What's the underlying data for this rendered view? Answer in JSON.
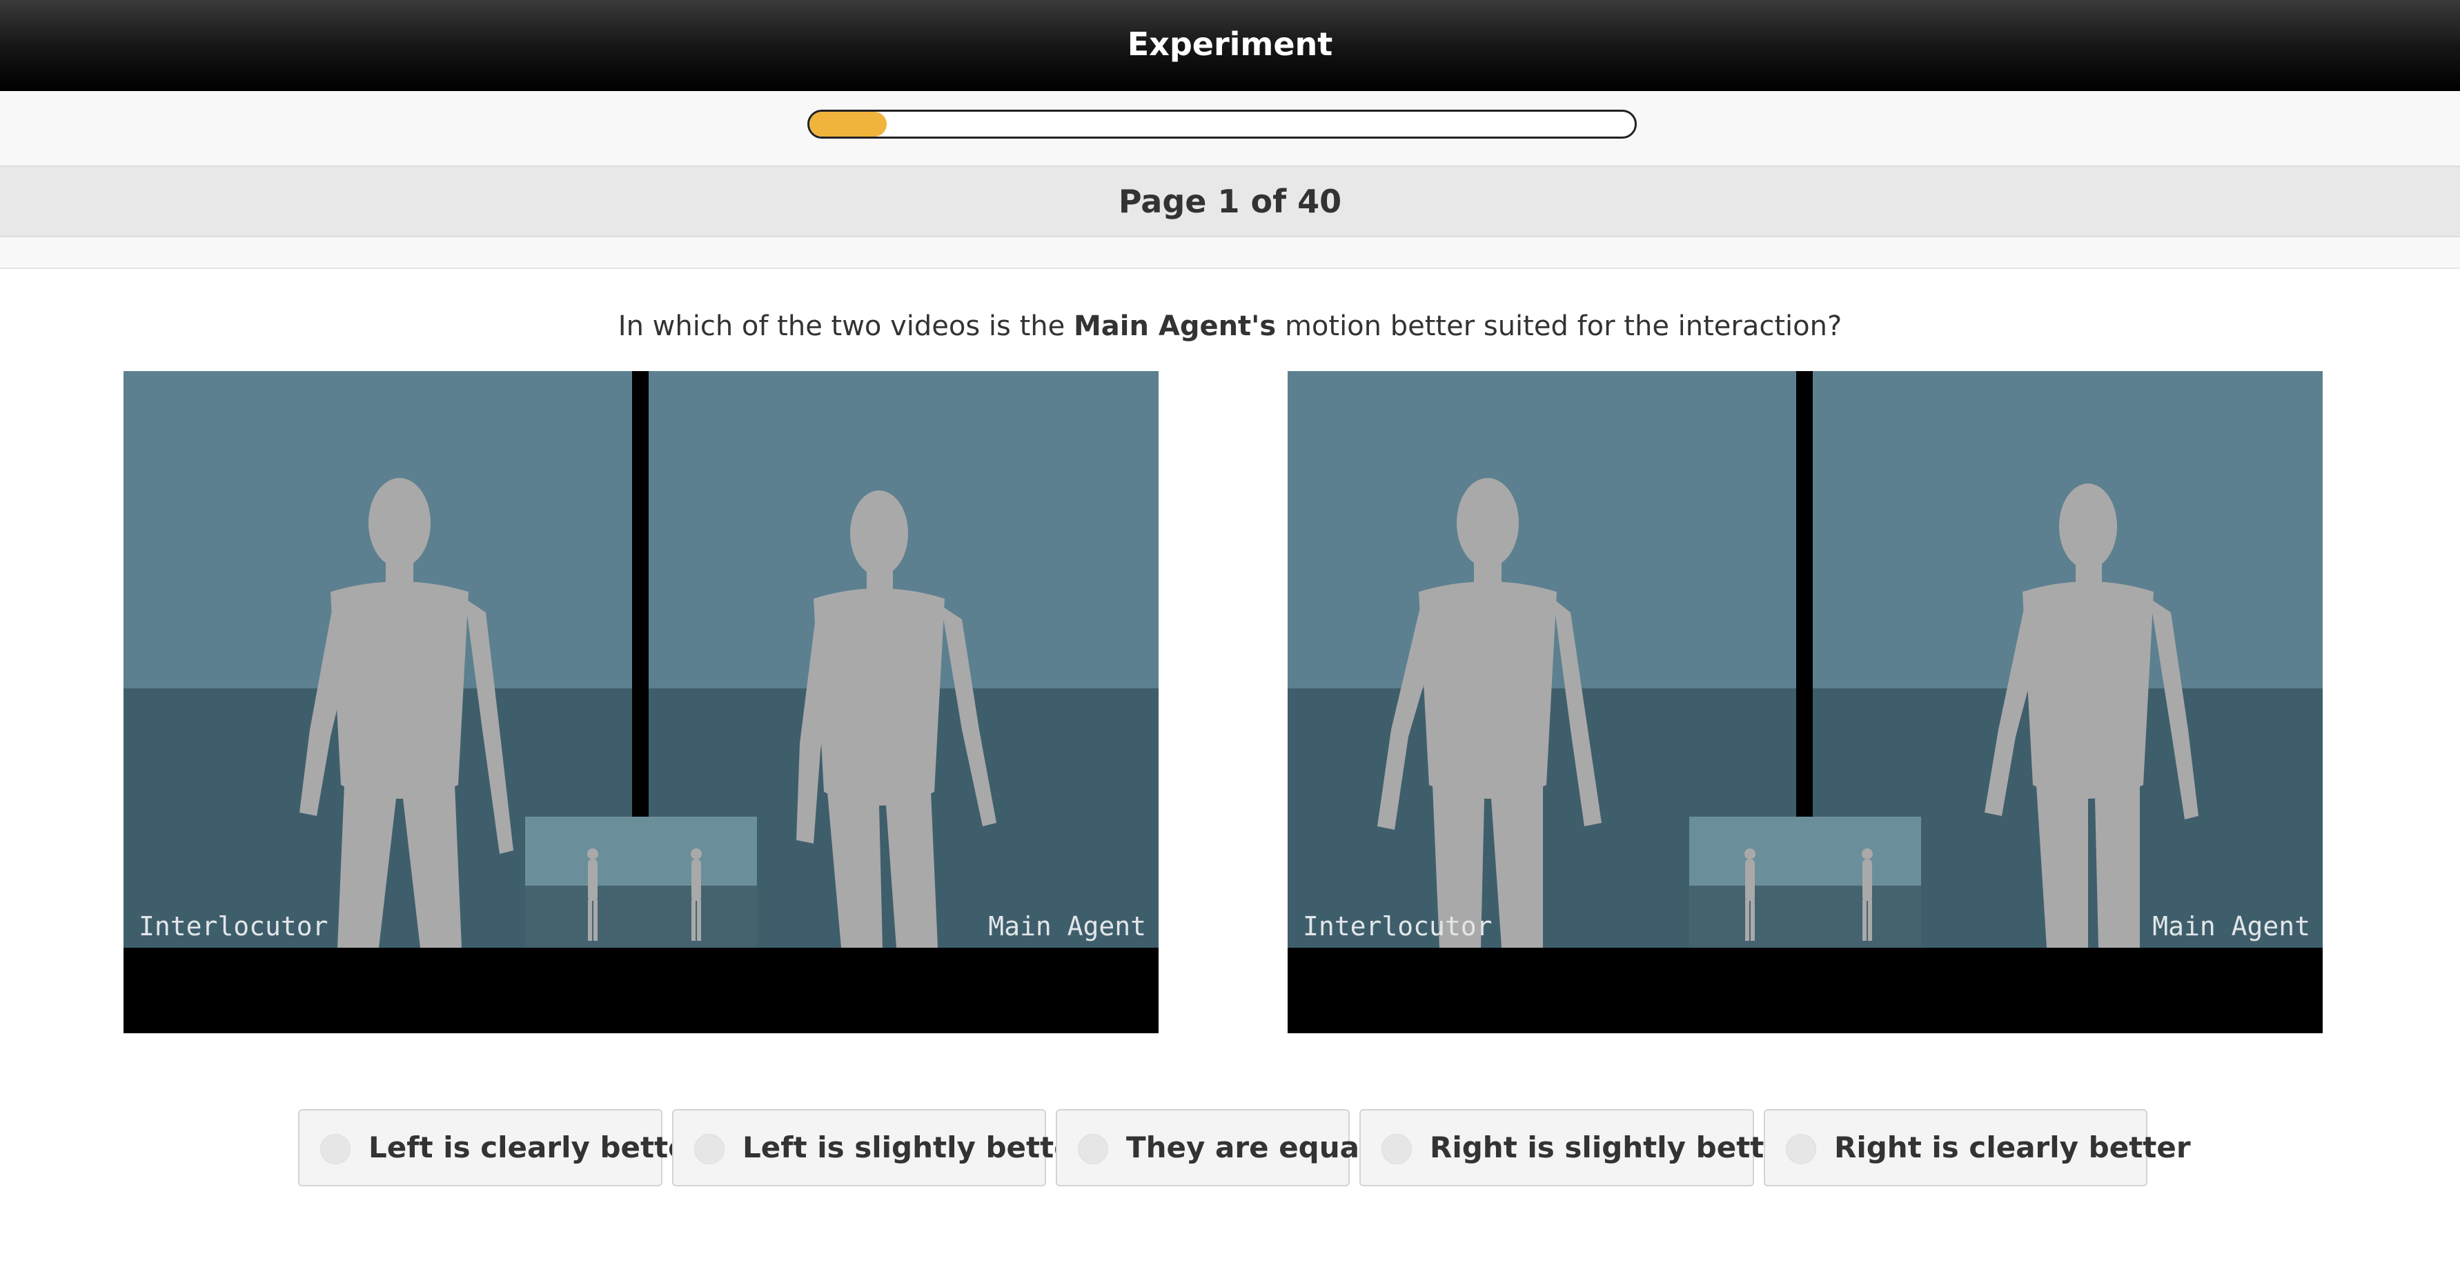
{
  "header": {
    "title": "Experiment"
  },
  "progress": {
    "fraction": 0.094,
    "accent_color": "#f0b43c"
  },
  "page": {
    "title": "Page 1 of 40"
  },
  "question": {
    "prefix": "In which of the two videos is the ",
    "emphasis": "Main Agent's",
    "suffix": " motion better suited for the interaction?"
  },
  "videos": [
    {
      "left_label": "Interlocutor",
      "right_label": "Main Agent"
    },
    {
      "left_label": "Interlocutor",
      "right_label": "Main Agent"
    }
  ],
  "options": [
    {
      "label": "Left is clearly better",
      "selected": false
    },
    {
      "label": "Left is slightly better",
      "selected": false
    },
    {
      "label": "They are equal",
      "selected": false
    },
    {
      "label": "Right is slightly better",
      "selected": false
    },
    {
      "label": "Right is clearly better",
      "selected": false
    }
  ]
}
